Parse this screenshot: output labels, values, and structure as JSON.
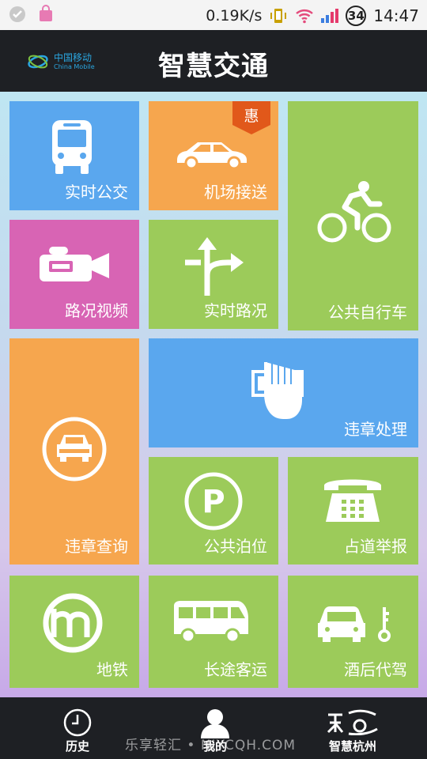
{
  "status_bar": {
    "net_speed": "0.19K/s",
    "battery_level": "34",
    "time": "14:47"
  },
  "header": {
    "carrier_cn": "中国移动",
    "carrier_en": "China Mobile",
    "title": "智慧交通"
  },
  "tiles": {
    "realtime_bus": "实时公交",
    "airport_transfer": "机场接送",
    "airport_badge": "惠",
    "public_bike": "公共自行车",
    "traffic_video": "路况视频",
    "realtime_traffic": "实时路况",
    "violation_handling": "违章处理",
    "violation_query": "违章查询",
    "public_parking": "公共泊位",
    "report_lane": "占道举报",
    "metro": "地铁",
    "long_distance_bus": "长途客运",
    "designated_driver": "酒后代驾"
  },
  "colors": {
    "blue": "#5aa7ee",
    "orange": "#f6a64e",
    "green": "#9ccb5a",
    "magenta": "#d864b4",
    "dark": "#1e2024"
  },
  "bottom_nav": {
    "history": "历史",
    "mine": "我的",
    "smart_hangzhou": "智慧杭州"
  },
  "watermark": "乐享轻汇 • NIYCQH.COM"
}
